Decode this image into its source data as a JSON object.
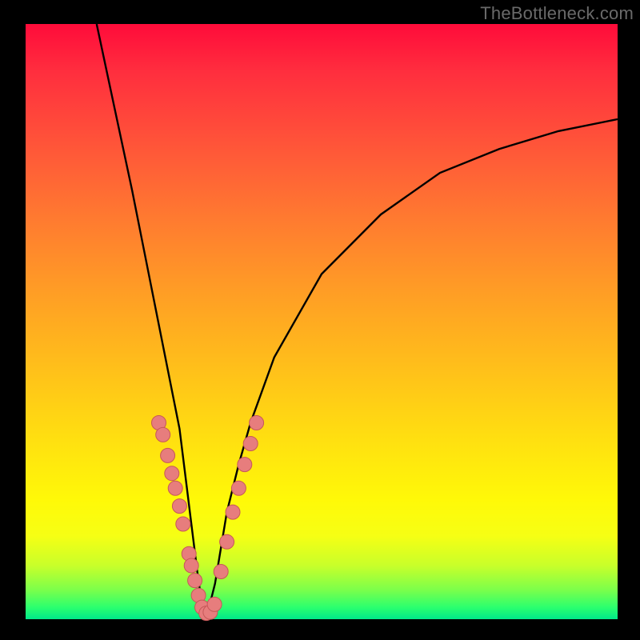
{
  "watermark": "TheBottleneck.com",
  "colors": {
    "background": "#000000",
    "curve_stroke": "#000000",
    "dot_fill": "#e77d7d",
    "dot_stroke": "#c65858",
    "gradient_top": "#ff0b3a",
    "gradient_bottom": "#00e88a"
  },
  "chart_data": {
    "type": "line",
    "title": "",
    "xlabel": "",
    "ylabel": "",
    "xlim": [
      0,
      100
    ],
    "ylim": [
      0,
      100
    ],
    "grid": false,
    "notes": "V-shaped bottleneck curve. x is an implied component-balance axis (0–100); y is an implied bottleneck-percentage axis (0–100, 100 at top). Minimum ≈ x=30, y≈0. No axis ticks or labels are shown.",
    "series": [
      {
        "name": "bottleneck_curve",
        "x": [
          12,
          15,
          18,
          20,
          22,
          24,
          26,
          27,
          28,
          29,
          30,
          31,
          32,
          33,
          34,
          36,
          38,
          42,
          50,
          60,
          70,
          80,
          90,
          100
        ],
        "y": [
          100,
          86,
          72,
          62,
          52,
          42,
          32,
          24,
          16,
          8,
          1,
          2,
          6,
          12,
          18,
          26,
          33,
          44,
          58,
          68,
          75,
          79,
          82,
          84
        ]
      }
    ],
    "highlight_points": {
      "name": "highlight_dots",
      "note": "Pink dots clustered along the lower V near the minimum",
      "x": [
        22.5,
        23.2,
        24.0,
        24.7,
        25.3,
        26.0,
        26.6,
        27.6,
        28.0,
        28.6,
        29.2,
        29.8,
        30.5,
        31.2,
        31.9,
        33.0,
        34.0,
        35.0,
        36.0,
        37.0,
        38.0,
        39.0
      ],
      "y": [
        33.0,
        31.0,
        27.5,
        24.5,
        22.0,
        19.0,
        16.0,
        11.0,
        9.0,
        6.5,
        4.0,
        2.0,
        1.0,
        1.2,
        2.5,
        8.0,
        13.0,
        18.0,
        22.0,
        26.0,
        29.5,
        33.0
      ]
    }
  }
}
